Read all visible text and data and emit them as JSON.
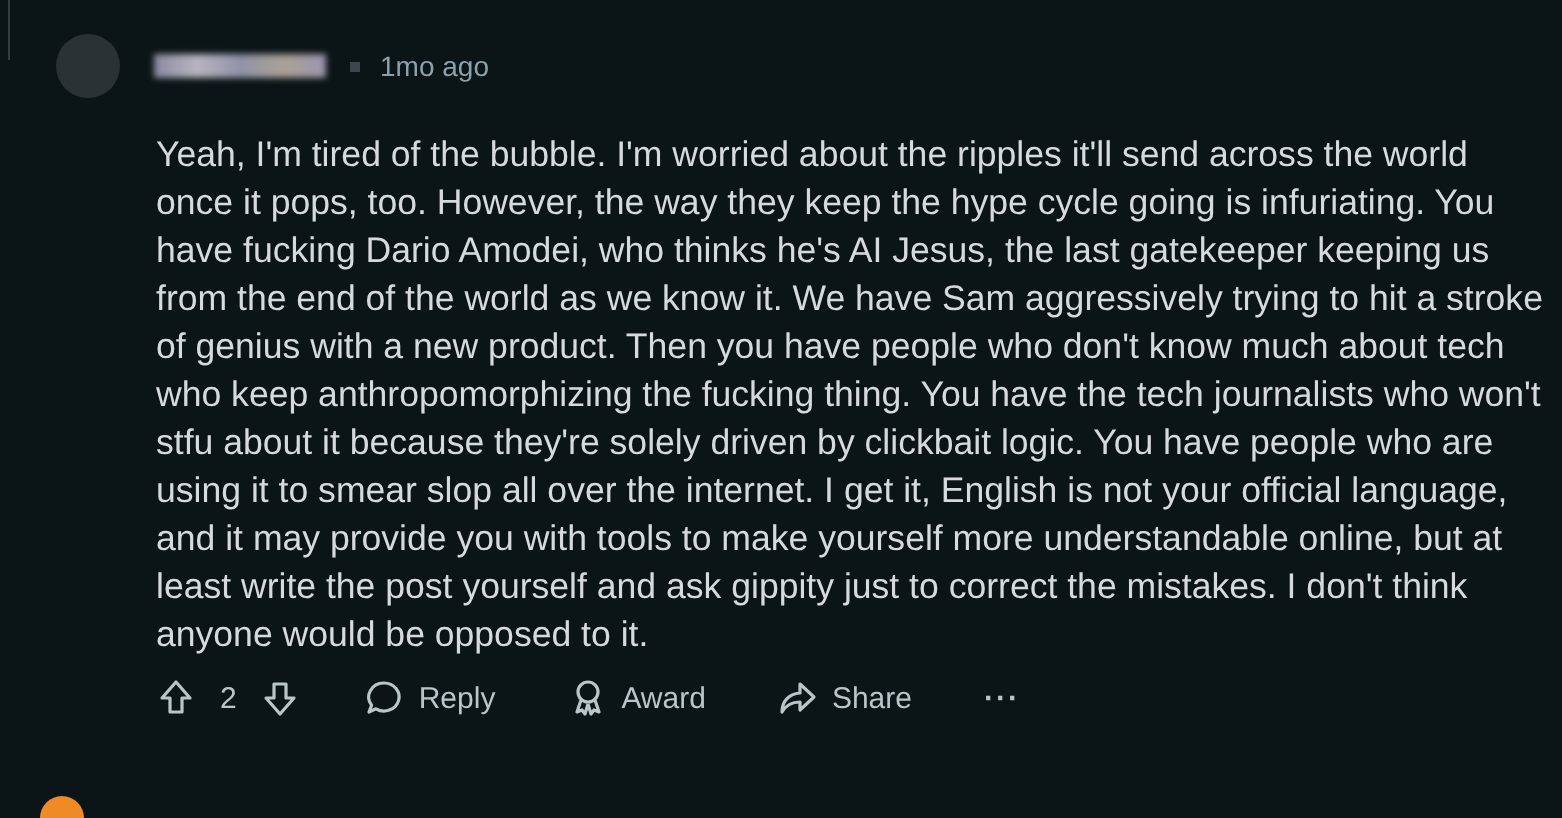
{
  "comment": {
    "time": "1mo ago",
    "body": "Yeah, I'm tired of the bubble. I'm worried about the ripples it'll send across the world once it pops, too. However, the way they keep the hype cycle going is infuriating. You have fucking Dario Amodei, who thinks he's AI Jesus, the last gatekeeper keeping us from the end of the world as we know it. We have Sam aggressively trying to hit a stroke of genius with a new product. Then you have people who don't know much about tech who keep anthropomorphizing the fucking thing. You have the tech journalists who won't stfu about it because they're solely driven by clickbait logic. You have people who are using it to smear slop all over the internet. I get it, English is not your official language, and it may provide you with tools to make yourself more understandable online, but at least write the post yourself and ask gippity just to correct the mistakes. I don't think anyone would be opposed to it.",
    "score": "2",
    "actions": [
      {
        "kind": "reply",
        "label": "Reply"
      },
      {
        "kind": "award",
        "label": "Award"
      },
      {
        "kind": "share",
        "label": "Share"
      },
      {
        "kind": "more",
        "label": "···"
      }
    ]
  }
}
